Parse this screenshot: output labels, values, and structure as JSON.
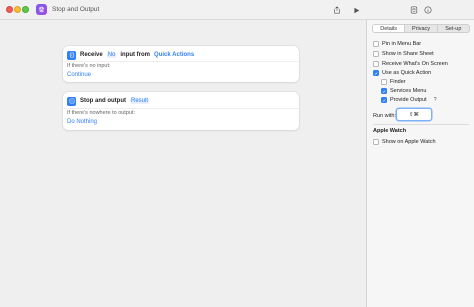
{
  "window": {
    "title": "Stop and Output"
  },
  "toolbar": {
    "share_icon": "share-icon",
    "run_icon": "play-icon",
    "library_icon": "library-icon",
    "info_icon": "info-icon"
  },
  "actions": [
    {
      "name": "Receive",
      "token1": "No",
      "text1": "input from",
      "token2": "Quick Actions",
      "sub_label": "If there's no input:",
      "link": "Continue"
    },
    {
      "name": "Stop and output",
      "token1": "Result",
      "sub_label": "If there's nowhere to output:",
      "link": "Do Nothing"
    }
  ],
  "inspector": {
    "tabs": [
      "Details",
      "Privacy",
      "Set-up"
    ],
    "active_tab": "Details",
    "options": [
      {
        "label": "Pin in Menu Bar",
        "checked": false,
        "indent": false
      },
      {
        "label": "Show in Share Sheet",
        "checked": false,
        "indent": false
      },
      {
        "label": "Receive What's On Screen",
        "checked": false,
        "indent": false
      },
      {
        "label": "Use as Quick Action",
        "checked": true,
        "indent": false
      },
      {
        "label": "Finder",
        "checked": false,
        "indent": true
      },
      {
        "label": "Services Menu",
        "checked": true,
        "indent": true
      },
      {
        "label": "Provide Output",
        "checked": true,
        "indent": true
      }
    ],
    "help_glyph": "?",
    "run_with_label": "Run with:",
    "run_with_value": "⇧⌘",
    "apple_watch_title": "Apple Watch",
    "apple_watch_option": {
      "label": "Show on Apple Watch",
      "checked": false
    }
  },
  "colors": {
    "accent": "#2f7ff5",
    "app_icon": "#8a52e6"
  }
}
